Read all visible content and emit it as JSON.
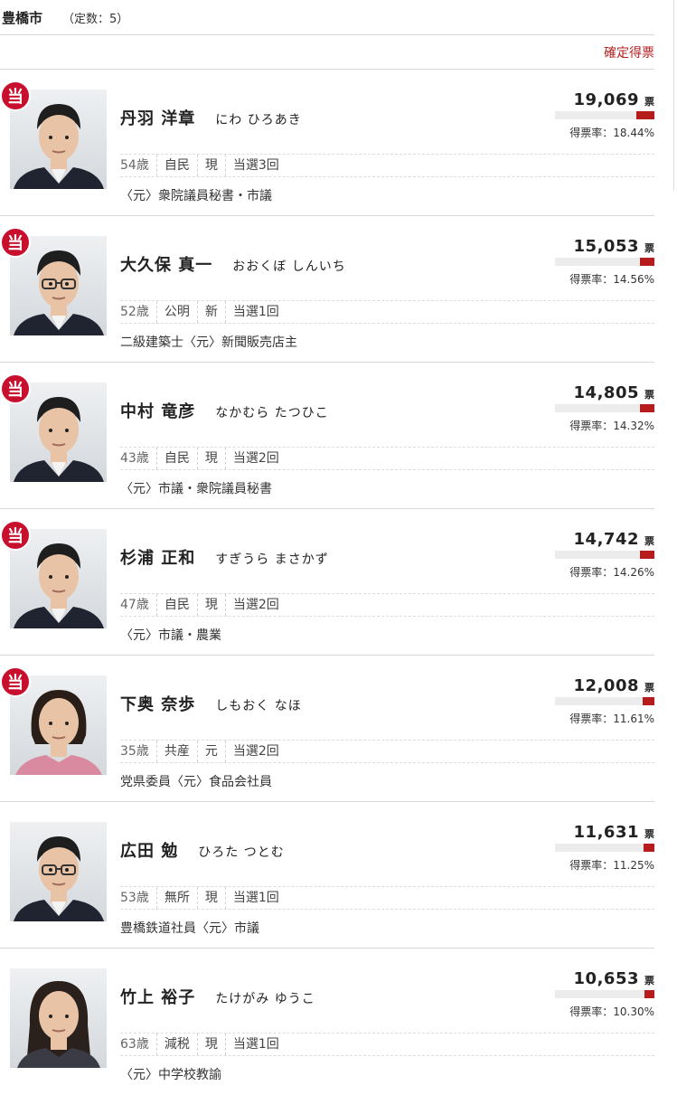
{
  "header": {
    "district": "豊橋市",
    "quota": "（定数：5）",
    "confirmed_label": "確定得票"
  },
  "candidates": [
    {
      "winner": true,
      "badge": "当",
      "name": "丹羽 洋章",
      "kana": "にわ ひろあき",
      "votes": "19,069",
      "unit": "票",
      "rate": "得票率：18.44%",
      "rate_value": 18.44,
      "age": "54歳",
      "party": "自民",
      "status": "現",
      "wins": "当選3回",
      "career": "〈元〉衆院議員秘書・市議",
      "photo": "man-dark-suit"
    },
    {
      "winner": true,
      "badge": "当",
      "name": "大久保 真一",
      "kana": "おおくぼ しんいち",
      "votes": "15,053",
      "unit": "票",
      "rate": "得票率：14.56%",
      "rate_value": 14.56,
      "age": "52歳",
      "party": "公明",
      "status": "新",
      "wins": "当選1回",
      "career": "二級建築士〈元〉新聞販売店主",
      "photo": "man-glasses"
    },
    {
      "winner": true,
      "badge": "当",
      "name": "中村 竜彦",
      "kana": "なかむら たつひこ",
      "votes": "14,805",
      "unit": "票",
      "rate": "得票率：14.32%",
      "rate_value": 14.32,
      "age": "43歳",
      "party": "自民",
      "status": "現",
      "wins": "当選2回",
      "career": "〈元〉市議・衆院議員秘書",
      "photo": "man-dark-suit"
    },
    {
      "winner": true,
      "badge": "当",
      "name": "杉浦 正和",
      "kana": "すぎうら まさかず",
      "votes": "14,742",
      "unit": "票",
      "rate": "得票率：14.26%",
      "rate_value": 14.26,
      "age": "47歳",
      "party": "自民",
      "status": "現",
      "wins": "当選2回",
      "career": "〈元〉市議・農業",
      "photo": "man-dark-suit"
    },
    {
      "winner": true,
      "badge": "当",
      "name": "下奥 奈歩",
      "kana": "しもおく なほ",
      "votes": "12,008",
      "unit": "票",
      "rate": "得票率：11.61%",
      "rate_value": 11.61,
      "age": "35歳",
      "party": "共産",
      "status": "元",
      "wins": "当選2回",
      "career": "党県委員〈元〉食品会社員",
      "photo": "woman-short-hair"
    },
    {
      "winner": false,
      "badge": "",
      "name": "広田 勉",
      "kana": "ひろた つとむ",
      "votes": "11,631",
      "unit": "票",
      "rate": "得票率：11.25%",
      "rate_value": 11.25,
      "age": "53歳",
      "party": "無所",
      "status": "現",
      "wins": "当選1回",
      "career": "豊橋鉄道社員〈元〉市議",
      "photo": "man-glasses"
    },
    {
      "winner": false,
      "badge": "",
      "name": "竹上 裕子",
      "kana": "たけがみ ゆうこ",
      "votes": "10,653",
      "unit": "票",
      "rate": "得票率：10.30%",
      "rate_value": 10.3,
      "age": "63歳",
      "party": "減税",
      "status": "現",
      "wins": "当選1回",
      "career": "〈元〉中学校教諭",
      "photo": "woman-long-hair"
    }
  ]
}
